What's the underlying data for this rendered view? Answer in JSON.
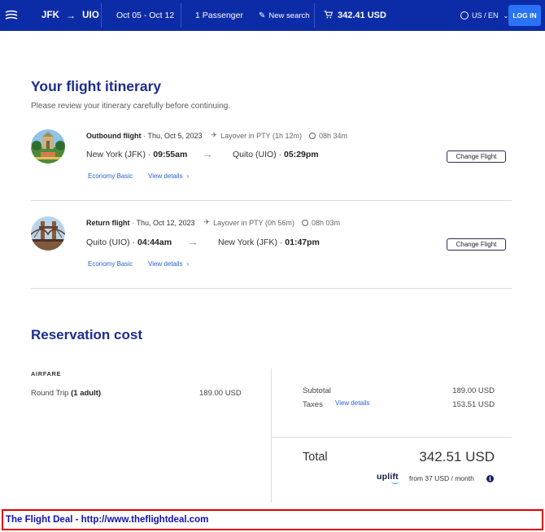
{
  "header": {
    "origin": "JFK",
    "destination": "UIO",
    "dates": "Oct 05 - Oct 12",
    "passengers": "1 Passenger",
    "new_search": "New search",
    "cart_total": "342.41 USD",
    "locale": "US / EN",
    "login": "LOG IN"
  },
  "itinerary": {
    "title": "Your flight itinerary",
    "subtitle": "Please review your itinerary carefully before continuing.",
    "flights": [
      {
        "label": "Outbound flight",
        "date": "Thu, Oct 5, 2023",
        "layover": "Layover in PTY (1h 12m)",
        "duration": "08h 34m",
        "from_city": "New York (JFK)",
        "from_time": "09:55am",
        "to_city": "Quito (UIO)",
        "to_time": "05:29pm",
        "fare": "Economy Basic",
        "details": "View details",
        "change": "Change Flight",
        "image": "city-park-photo"
      },
      {
        "label": "Return flight",
        "date": "Thu, Oct 12, 2023",
        "layover": "Layover in PTY (0h 56m)",
        "duration": "08h 03m",
        "from_city": "Quito (UIO)",
        "from_time": "04:44am",
        "to_city": "New York (JFK)",
        "to_time": "01:47pm",
        "fare": "Economy Basic",
        "details": "View details",
        "change": "Change Flight",
        "image": "brooklyn-bridge-photo"
      }
    ]
  },
  "cost": {
    "title": "Reservation cost",
    "airfare_heading": "AIRFARE",
    "trip_type": "Round Trip",
    "travellers": "(1 adult)",
    "trip_price": "189.00 USD",
    "subtotal_label": "Subtotal",
    "subtotal_value": "189.00 USD",
    "taxes_label": "Taxes",
    "taxes_link": "View details",
    "taxes_value": "153.51 USD",
    "total_label": "Total",
    "total_value": "342.51 USD",
    "uplift_brand": "uplift",
    "uplift_offer": "from 37 USD  / month",
    "info_glyph": "i"
  },
  "banner": {
    "text": "The Flight Deal - http://www.theflightdeal.com"
  },
  "colors": {
    "header_bg": "#0c2ba6",
    "login_bg": "#2a73f5",
    "heading": "#1d2d8c",
    "link": "#2a62d8",
    "banner_border": "#e00000",
    "banner_text": "#1010b8"
  },
  "icons": {
    "logo": "airline-logo-icon",
    "route_arrow": "arrow-right-icon",
    "edit": "pencil-icon",
    "cart": "cart-icon",
    "globe": "globe-icon",
    "plane": "plane-icon",
    "clock": "clock-icon",
    "info": "info-icon"
  }
}
